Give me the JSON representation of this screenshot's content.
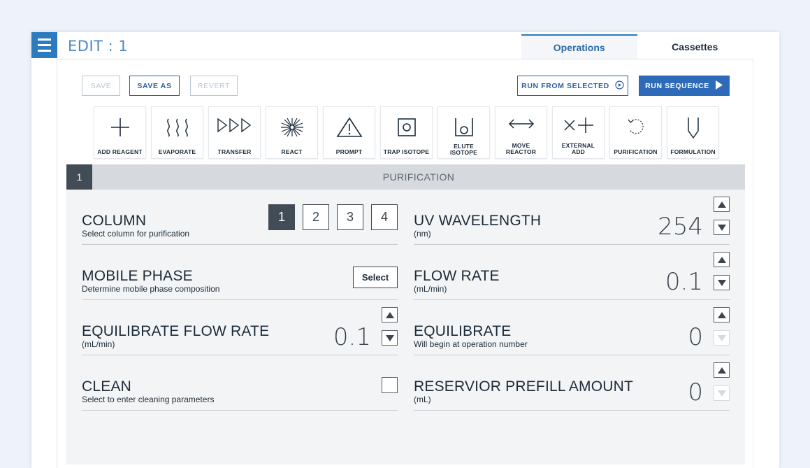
{
  "header": {
    "title": "EDIT : 1",
    "menu_icon": "hamburger-menu-icon",
    "tabs": [
      {
        "label": "Operations",
        "active": true
      },
      {
        "label": "Cassettes",
        "active": false
      }
    ]
  },
  "toolbar": {
    "save": "SAVE",
    "save_as": "SAVE AS",
    "revert": "REVERT",
    "run_from_selected": "RUN FROM SELECTED",
    "run_sequence": "RUN SEQUENCE"
  },
  "operations": [
    {
      "label": "ADD REAGENT",
      "icon": "plus-icon"
    },
    {
      "label": "EVAPORATE",
      "icon": "evaporate-waves-icon"
    },
    {
      "label": "TRANSFER",
      "icon": "transfer-triangles-icon"
    },
    {
      "label": "REACT",
      "icon": "react-burst-icon"
    },
    {
      "label": "PROMPT",
      "icon": "warning-triangle-icon"
    },
    {
      "label": "TRAP ISOTOPE",
      "icon": "trap-isotope-icon"
    },
    {
      "label": "ELUTE ISOTOPE",
      "icon": "elute-isotope-icon"
    },
    {
      "label": "MOVE REACTOR",
      "icon": "double-arrow-icon"
    },
    {
      "label": "EXTERNAL ADD",
      "icon": "external-add-icon"
    },
    {
      "label": "PURIFICATION",
      "icon": "purification-cycle-icon"
    },
    {
      "label": "FORMULATION",
      "icon": "formulation-vial-icon"
    }
  ],
  "panel": {
    "number": "1",
    "title": "PURIFICATION"
  },
  "fields": {
    "column": {
      "title": "COLUMN",
      "sub": "Select column for purification",
      "options": [
        "1",
        "2",
        "3",
        "4"
      ],
      "selected": "1"
    },
    "uv_wavelength": {
      "title": "UV WAVELENGTH",
      "sub": "(nm)",
      "value": "254"
    },
    "mobile_phase": {
      "title": "MOBILE PHASE",
      "sub": "Determine mobile phase composition",
      "button": "Select"
    },
    "flow_rate": {
      "title": "FLOW RATE",
      "sub": "(mL/min)",
      "value": "0.1"
    },
    "equilibrate_flow_rate": {
      "title": "EQUILIBRATE FLOW RATE",
      "sub": "(mL/min)",
      "value": "0.1"
    },
    "equilibrate": {
      "title": "EQUILIBRATE",
      "sub": "Will begin at operation number",
      "value": "0"
    },
    "clean": {
      "title": "CLEAN",
      "sub": "Select to enter cleaning parameters",
      "checked": false
    },
    "reservoir_prefill": {
      "title": "RESERVIOR PREFILL AMOUNT",
      "sub": "(mL)",
      "value": "0"
    }
  },
  "colors": {
    "accent": "#2d7bbf",
    "primary_button": "#2d6ab8",
    "selected_dark": "#424c56",
    "panel_header": "#d6d9dd",
    "panel_body": "#f3f4f5"
  }
}
